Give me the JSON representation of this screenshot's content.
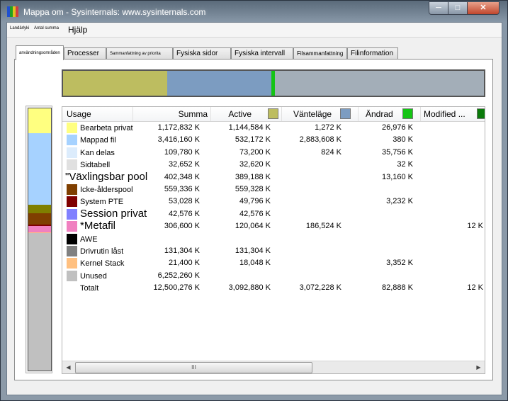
{
  "window": {
    "title": "Mappa om - Sysinternals: www.sysinternals.com"
  },
  "menu": {
    "items": [
      "Landärlyki",
      "Antal summa",
      "Hjälp"
    ]
  },
  "tabs": [
    "användningsområden",
    "Processer",
    "Sammanfattning av priorita",
    "Fysiska sidor",
    "Fysiska intervall",
    "Filsammanfattning",
    "Filinformation"
  ],
  "active_tab": 0,
  "overview_bar": [
    {
      "color": "#bdbd60",
      "fraction": 0.247
    },
    {
      "color": "#7c9cc1",
      "fraction": 0.248
    },
    {
      "color": "#14c414",
      "fraction": 0.008
    },
    {
      "color": "#a3aeb8",
      "fraction": 0.497
    }
  ],
  "usage_bar": [
    {
      "color": "#ffff80",
      "fraction": 0.094
    },
    {
      "color": "#a6d2ff",
      "fraction": 0.273
    },
    {
      "color": "#7f7f00",
      "fraction": 0.032
    },
    {
      "color": "#7f3f00",
      "fraction": 0.045
    },
    {
      "color": "#7f0000",
      "fraction": 0.004
    },
    {
      "color": "#f080c0",
      "fraction": 0.025
    },
    {
      "color": "#ffc080",
      "fraction": 0.002
    },
    {
      "color": "#c0c0c0",
      "fraction": 0.525
    }
  ],
  "columns": {
    "usage": "Usage",
    "summa": "Summa",
    "active": "Active",
    "active_color": "#bdbd60",
    "standby": "Vänteläge",
    "standby_color": "#7c9cc1",
    "modified": "Ändrad",
    "modified_color": "#14c414",
    "modified_nw": "Modified ...",
    "modified_nw_color": "#0a7a0a"
  },
  "rows": [
    {
      "color": "#ffff80",
      "label": "Bearbeta privat",
      "size": "normal",
      "summa": "1,172,832 K",
      "active": "1,144,584 K",
      "standby": "1,272 K",
      "modified": "26,976 K",
      "modified_nw": ""
    },
    {
      "color": "#a6d2ff",
      "label": "Mappad fil",
      "size": "normal",
      "summa": "3,416,160 K",
      "active": "532,172 K",
      "standby": "2,883,608 K",
      "modified": "380 K",
      "modified_nw": ""
    },
    {
      "color": "#dcecfc",
      "label": "Kan delas",
      "size": "normal",
      "summa": "109,780 K",
      "active": "73,200 K",
      "standby": "824 K",
      "modified": "35,756 K",
      "modified_nw": ""
    },
    {
      "color": "#e0e0e0",
      "label": "Sidtabell",
      "size": "normal",
      "summa": "32,652 K",
      "active": "32,620 K",
      "standby": "",
      "modified": "32 K",
      "modified_nw": ""
    },
    {
      "color": "",
      "label": "\"Växlingsbar pool",
      "size": "big",
      "summa": "402,348 K",
      "active": "389,188 K",
      "standby": "",
      "modified": "13,160 K",
      "modified_nw": ""
    },
    {
      "color": "#7f3f00",
      "label": "Icke-ålderspool",
      "size": "normal",
      "summa": "559,336 K",
      "active": "559,328 K",
      "standby": "",
      "modified": "",
      "modified_nw": ""
    },
    {
      "color": "#7f0000",
      "label": "System PTE",
      "size": "normal",
      "summa": "53,028 K",
      "active": "49,796 K",
      "standby": "",
      "modified": "3,232 K",
      "modified_nw": ""
    },
    {
      "color": "#8080ff",
      "label": "Session privat",
      "size": "big",
      "summa": "42,576 K",
      "active": "42,576 K",
      "standby": "",
      "modified": "",
      "modified_nw": ""
    },
    {
      "color": "#f080c0",
      "label": "*Metafil",
      "size": "big",
      "summa": "306,600 K",
      "active": "120,064 K",
      "standby": "186,524 K",
      "modified": "",
      "modified_nw": "12 K"
    },
    {
      "color": "#000000",
      "label": "AWE",
      "size": "normal",
      "summa": "",
      "active": "",
      "standby": "",
      "modified": "",
      "modified_nw": ""
    },
    {
      "color": "#808080",
      "label": "Drivrutin låst",
      "size": "normal",
      "summa": "131,304 K",
      "active": "131,304 K",
      "standby": "",
      "modified": "",
      "modified_nw": ""
    },
    {
      "color": "#ffc080",
      "label": "Kernel Stack",
      "size": "normal",
      "summa": "21,400 K",
      "active": "18,048 K",
      "standby": "",
      "modified": "3,352 K",
      "modified_nw": ""
    },
    {
      "color": "#c0c0c0",
      "label": "Unused",
      "size": "normal",
      "summa": "6,252,260 K",
      "active": "",
      "standby": "",
      "modified": "",
      "modified_nw": ""
    },
    {
      "color": "",
      "label": "Totalt",
      "size": "normal",
      "summa": "12,500,276 K",
      "active": "3,092,880 K",
      "standby": "3,072,228 K",
      "modified": "82,888 K",
      "modified_nw": "12 K"
    }
  ],
  "scrollbar": {
    "thumb_glyph": "III"
  }
}
